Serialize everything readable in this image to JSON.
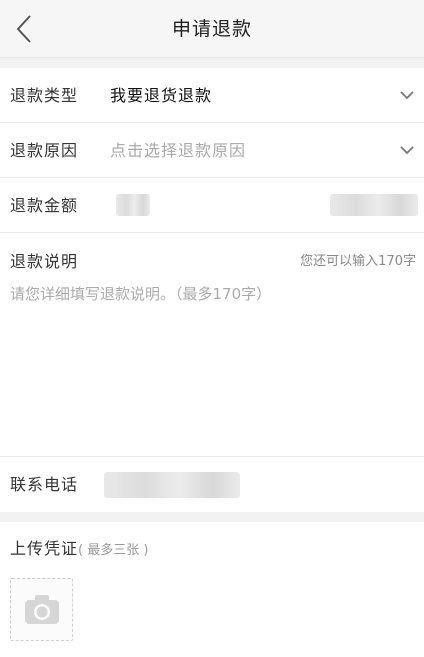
{
  "header": {
    "title": "申请退款"
  },
  "form": {
    "refund_type": {
      "label": "退款类型",
      "value": "我要退货退款"
    },
    "refund_reason": {
      "label": "退款原因",
      "placeholder": "点击选择退款原因"
    },
    "refund_amount": {
      "label": "退款金额"
    },
    "description": {
      "label": "退款说明",
      "counter": "您还可以输入170字",
      "placeholder": "请您详细填写退款说明。（最多170字）"
    },
    "phone": {
      "label": "联系电话"
    }
  },
  "upload": {
    "title": "上传凭证",
    "hint": "( 最多三张 )",
    "icon": "camera-icon"
  },
  "colors": {
    "page_background": "#f2f2f2",
    "card_background": "#ffffff",
    "placeholder_text": "#aaaaaa",
    "divider": "#e8e8e8"
  }
}
